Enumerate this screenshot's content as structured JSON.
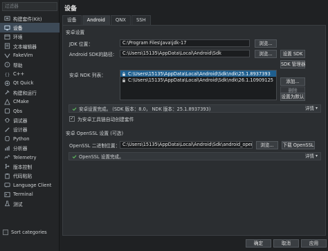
{
  "sidebar": {
    "filter_placeholder": "过滤器",
    "items": [
      {
        "label": "构建套件(Kit)",
        "icon": "kit-icon"
      },
      {
        "label": "设备",
        "icon": "device-icon",
        "selected": true
      },
      {
        "label": "环境",
        "icon": "environment-icon"
      },
      {
        "label": "文本编辑器",
        "icon": "text-editor-icon"
      },
      {
        "label": "FakeVim",
        "icon": "fakevim-icon"
      },
      {
        "label": "帮助",
        "icon": "help-icon"
      },
      {
        "label": "C++",
        "icon": "cpp-icon"
      },
      {
        "label": "Qt Quick",
        "icon": "qtquick-icon"
      },
      {
        "label": "构建和运行",
        "icon": "build-run-icon"
      },
      {
        "label": "CMake",
        "icon": "cmake-icon"
      },
      {
        "label": "Qbs",
        "icon": "qbs-icon"
      },
      {
        "label": "调试器",
        "icon": "debugger-icon"
      },
      {
        "label": "设计器",
        "icon": "designer-icon"
      },
      {
        "label": "Python",
        "icon": "python-icon"
      },
      {
        "label": "分析器",
        "icon": "analyzer-icon"
      },
      {
        "label": "Telemetry",
        "icon": "telemetry-icon"
      },
      {
        "label": "版本控制",
        "icon": "version-control-icon"
      },
      {
        "label": "代码粘贴",
        "icon": "code-paste-icon"
      },
      {
        "label": "Language Client",
        "icon": "language-client-icon"
      },
      {
        "label": "Terminal",
        "icon": "terminal-icon"
      },
      {
        "label": "测试",
        "icon": "test-icon"
      }
    ],
    "sort_label": "Sort categories"
  },
  "main": {
    "title": "设备",
    "tabs": [
      "设备",
      "Android",
      "QNX",
      "SSH"
    ],
    "active_tab": "Android",
    "android_settings": {
      "group_title": "安卓设置",
      "jdk_label": "JDK 位置：",
      "jdk_value": "C:\\Program Files\\Java\\jdk-17",
      "sdk_label": "Android SDK的路径:",
      "sdk_value": "C:\\Users\\15135\\AppData\\Local\\Android\\Sdk",
      "browse": "浏览...",
      "setup_sdk": "设置 SDK",
      "sdk_manager": "SDK 管理器",
      "ndk_label": "安卓 NDK 列表：",
      "ndk_list": [
        "C:\\Users\\15135\\AppData\\Local\\Android\\Sdk\\ndk\\25.1.8937393",
        "C:\\Users\\15135\\AppData\\Local\\Android\\Sdk\\ndk\\26.1.10909125"
      ],
      "add": "添加...",
      "remove": "删除",
      "set_default": "设置为默认",
      "status_text": "安卓设置完成。     (SDK 版本：8.0，  NDK 版本：25.1.8937393)",
      "details": "详情",
      "auto_create_kits": "为安卓工具链自动创建套件"
    },
    "openssl": {
      "group_title": "安卓 OpenSSL 设置 (可选)",
      "path_label": "OpenSSL 二进制位置：",
      "path_value": "C:\\Users\\15135\\AppData\\Local\\Android\\Sdk\\android_openssl",
      "browse": "浏览...",
      "download": "下载 OpenSSL",
      "status_text": "OpenSSL 设置完成。",
      "details": "详情"
    }
  },
  "footer": {
    "ok": "确定",
    "cancel": "取消",
    "apply": "应用"
  },
  "colors": {
    "selection": "#3d4a57",
    "ndk_selection": "#1f5f8f",
    "ok_green": "#5cb85c"
  }
}
